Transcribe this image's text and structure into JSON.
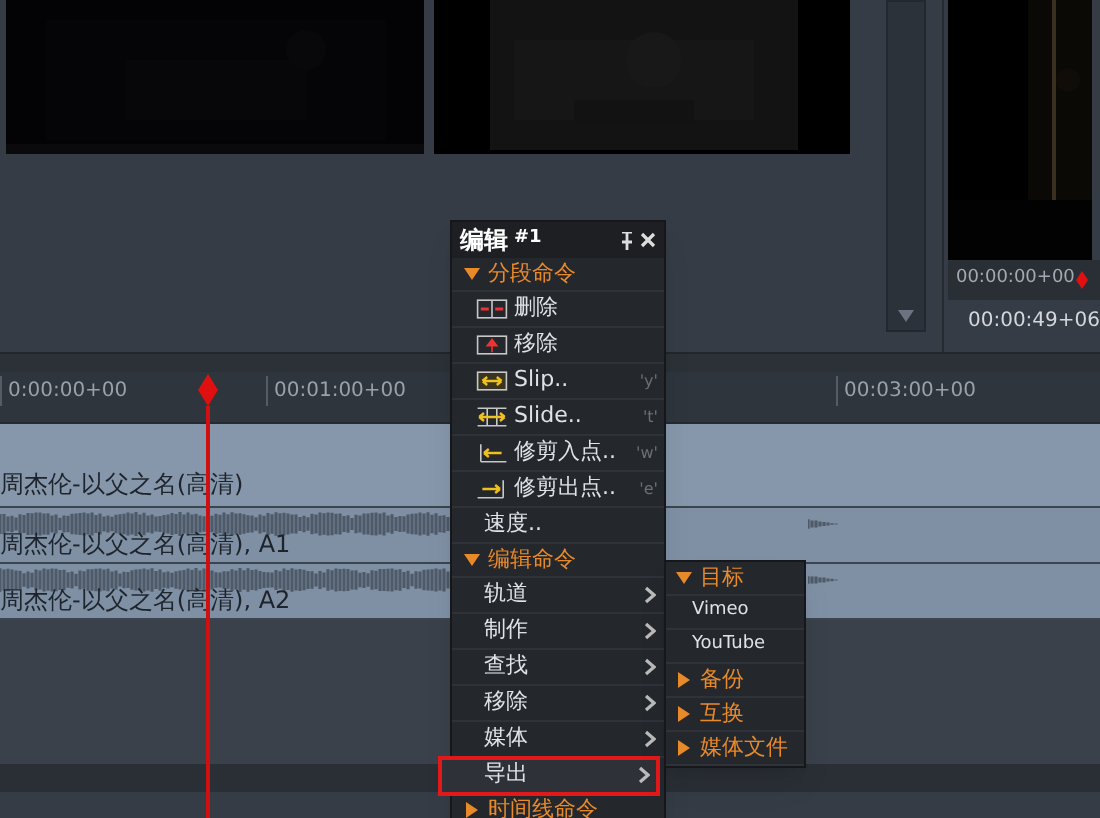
{
  "program_monitor": {
    "timecode_current": "00:00:00+00",
    "timecode_duration": "00:00:49+06"
  },
  "timeline": {
    "ruler_labels": [
      "0:00:00+00",
      "00:01:00+00",
      "00:03:00+00"
    ],
    "tracks": [
      {
        "kind": "video",
        "label": "周杰伦-以父之名(高清)"
      },
      {
        "kind": "audio",
        "label": "周杰伦-以父之名(高清), A1"
      },
      {
        "kind": "audio",
        "label": "周杰伦-以父之名(高清), A2"
      }
    ]
  },
  "menu": {
    "title": "编辑",
    "badge": "#1",
    "sections": [
      {
        "label": "分段命令",
        "expanded": true,
        "items": [
          {
            "kind": "command",
            "label": "删除"
          },
          {
            "kind": "command",
            "label": "移除"
          },
          {
            "kind": "command",
            "label": "Slip..",
            "shortcut": "'y'"
          },
          {
            "kind": "command",
            "label": "Slide..",
            "shortcut": "'t'"
          },
          {
            "kind": "command",
            "label": "修剪入点..",
            "shortcut": "'w'"
          },
          {
            "kind": "command",
            "label": "修剪出点..",
            "shortcut": "'e'"
          },
          {
            "kind": "plain",
            "label": "速度.."
          }
        ]
      },
      {
        "label": "编辑命令",
        "expanded": true,
        "items": [
          {
            "kind": "submenu",
            "label": "轨道",
            "selected": false
          },
          {
            "kind": "submenu",
            "label": "制作",
            "selected": false
          },
          {
            "kind": "submenu",
            "label": "查找",
            "selected": false
          },
          {
            "kind": "submenu",
            "label": "移除",
            "selected": false
          },
          {
            "kind": "submenu",
            "label": "媒体",
            "selected": false
          },
          {
            "kind": "submenu",
            "label": "导出",
            "selected": true
          }
        ]
      },
      {
        "label": "时间线命令",
        "expanded": false
      }
    ]
  },
  "submenu": {
    "sections": [
      {
        "label": "目标",
        "expanded": true,
        "items": [
          "Vimeo",
          "YouTube"
        ]
      },
      {
        "label": "备份",
        "expanded": false
      },
      {
        "label": "互换",
        "expanded": false
      },
      {
        "label": "媒体文件",
        "expanded": false
      }
    ]
  }
}
